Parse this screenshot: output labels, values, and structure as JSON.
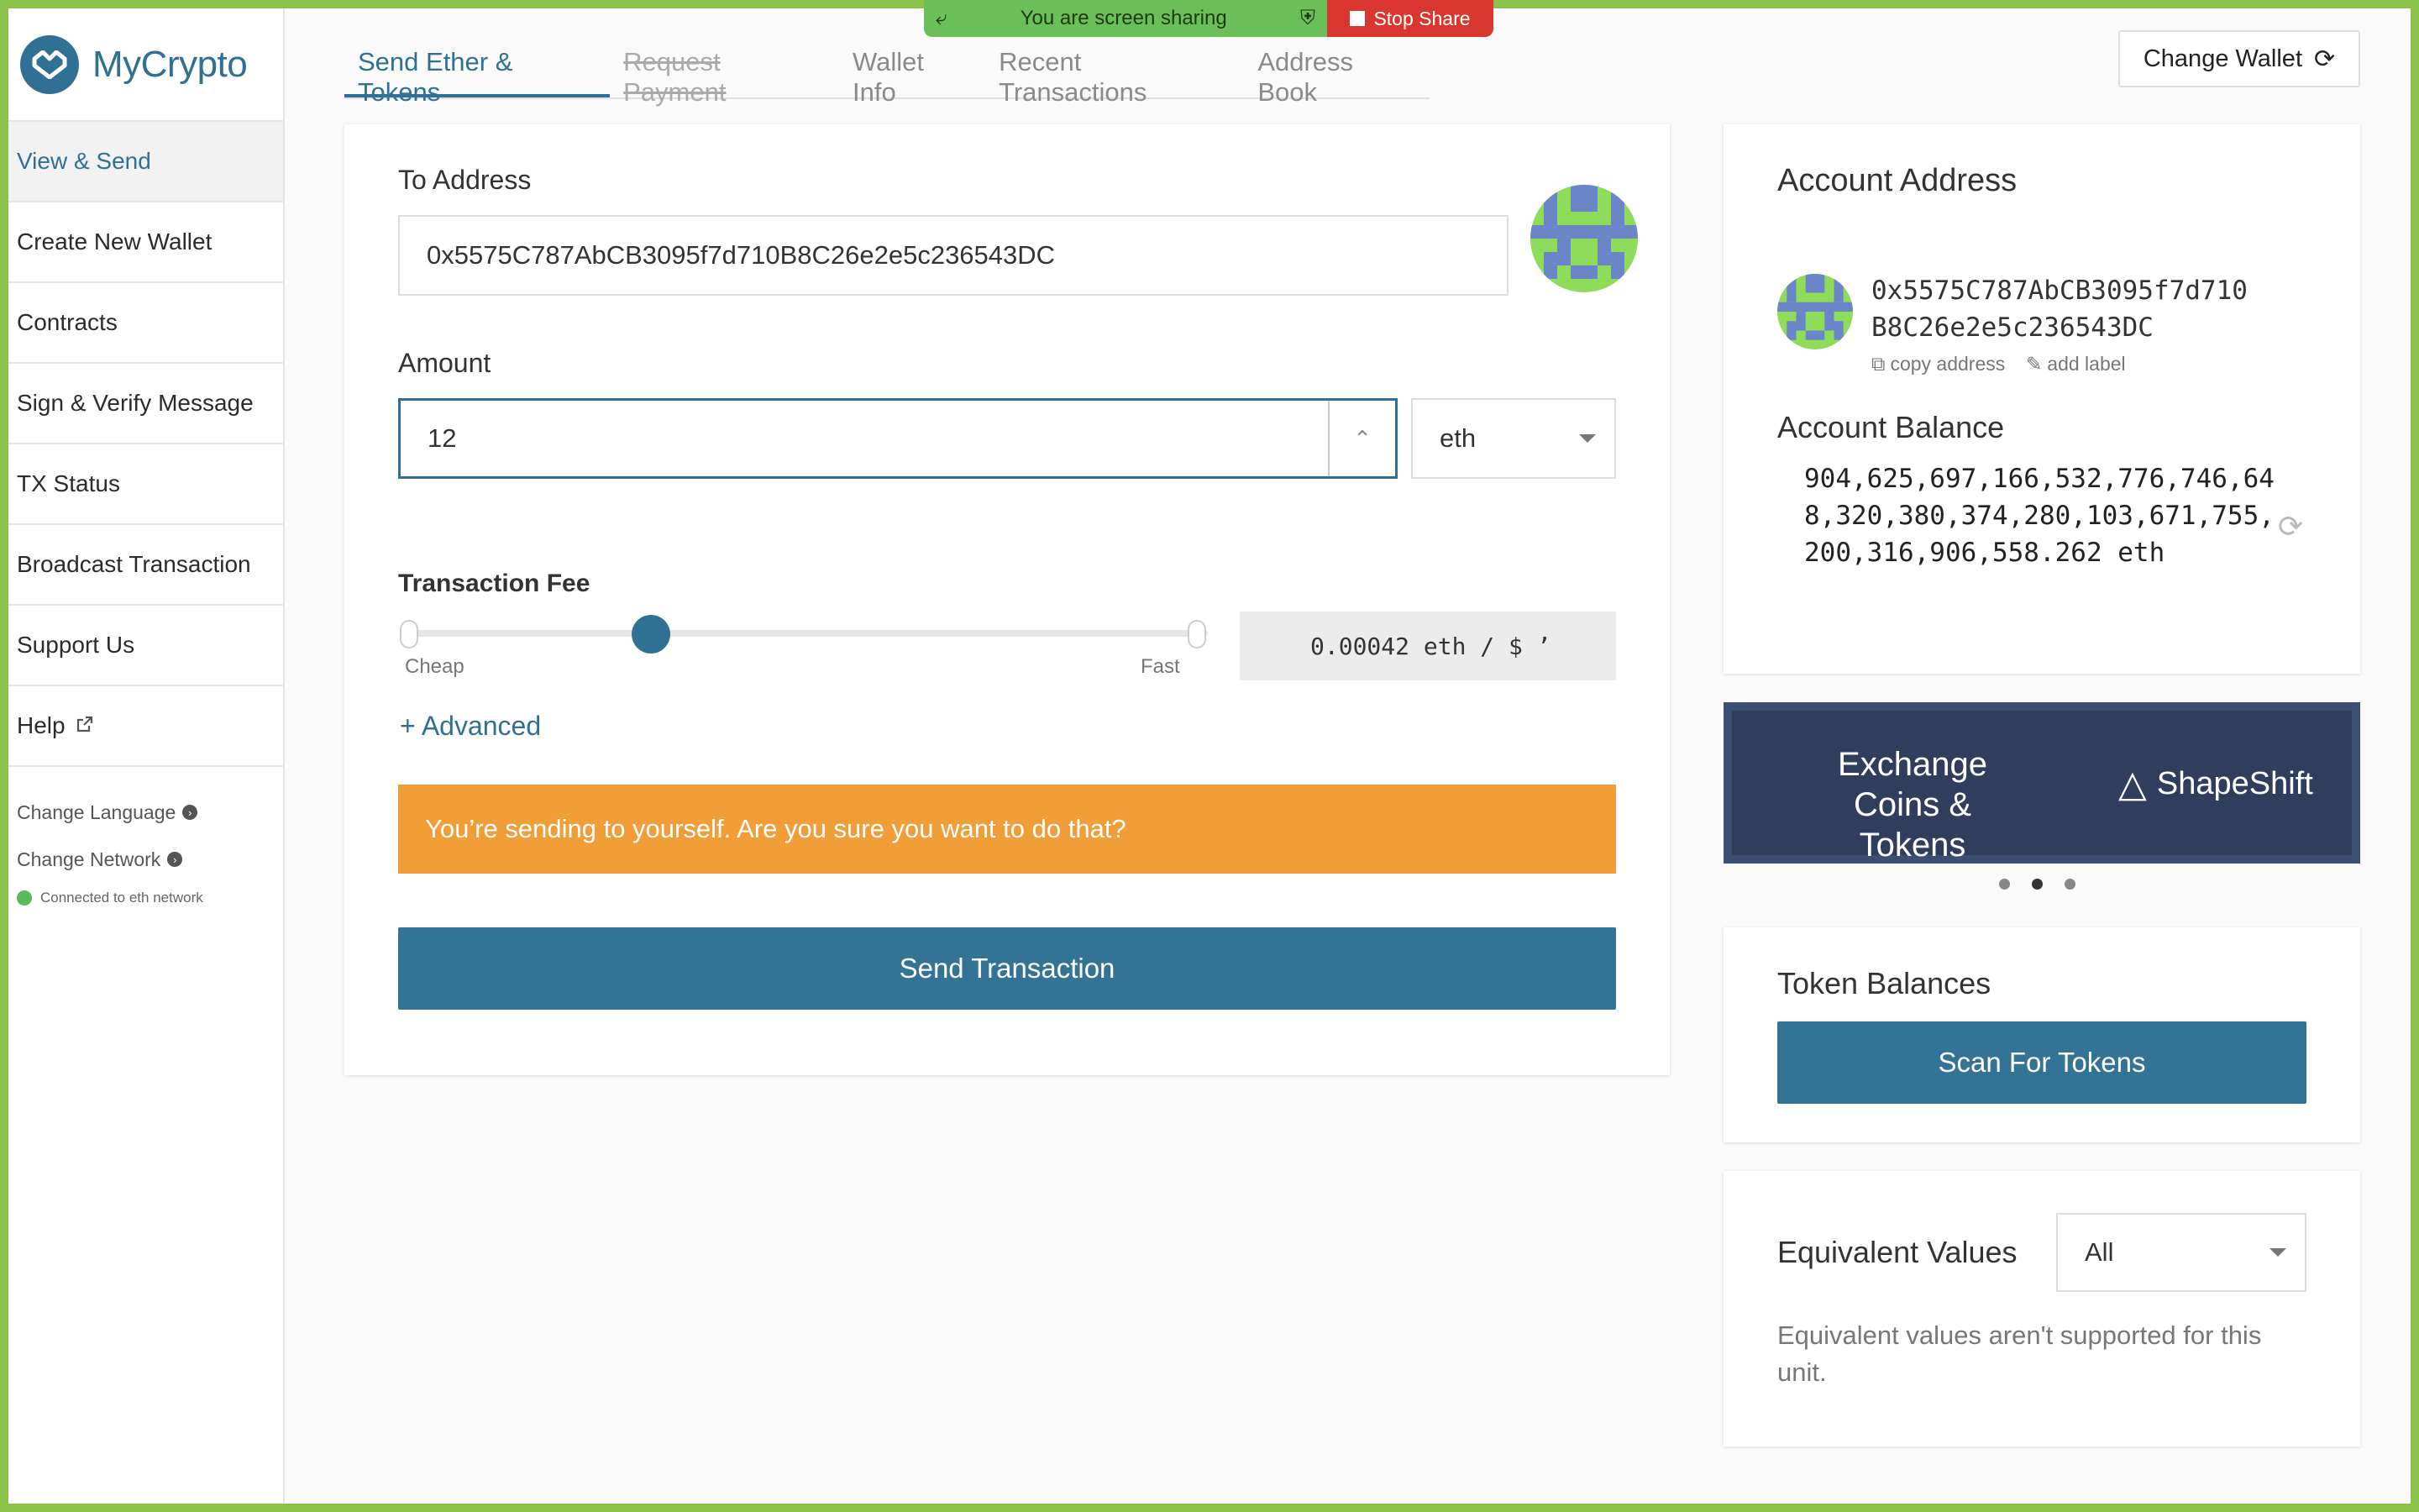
{
  "brand": {
    "name": "MyCrypto",
    "color": "#2f7094"
  },
  "screen_share": {
    "status": "You are screen sharing",
    "stop_label": "Stop Share"
  },
  "sidebar": {
    "items": [
      {
        "label": "View & Send",
        "active": true
      },
      {
        "label": "Create New Wallet"
      },
      {
        "label": "Contracts"
      },
      {
        "label": "Sign & Verify Message"
      },
      {
        "label": "TX Status"
      },
      {
        "label": "Broadcast Transaction"
      },
      {
        "label": "Support Us"
      },
      {
        "label": "Help",
        "icon": "external-link-icon"
      }
    ],
    "change_language": "Change Language",
    "change_network": "Change Network",
    "network_status": "Connected to eth network"
  },
  "tabs": [
    {
      "label": "Send Ether & Tokens",
      "active": true
    },
    {
      "label": "Request Payment",
      "disabled": true
    },
    {
      "label": "Wallet Info"
    },
    {
      "label": "Recent Transactions"
    },
    {
      "label": "Address Book"
    }
  ],
  "header": {
    "change_wallet_label": "Change Wallet"
  },
  "send_form": {
    "to_address_label": "To Address",
    "to_address_value": "0x5575C787AbCB3095f7d710B8C26e2e5c236543DC",
    "amount_label": "Amount",
    "amount_value": "12",
    "unit": "eth",
    "fee_label": "Transaction Fee",
    "fee_cheap": "Cheap",
    "fee_fast": "Fast",
    "fee_value": "0.00042 eth / $ ʼ",
    "advanced_label": "+ Advanced",
    "warning": "You’re sending to yourself. Are you sure you want to do that?",
    "send_button": "Send Transaction"
  },
  "account": {
    "title": "Account Address",
    "address_line1": "0x5575C787AbCB3095f7d710",
    "address_line2": "B8C26e2e5c236543DC",
    "copy_label": "copy address",
    "add_label": "add label",
    "balance_title": "Account Balance",
    "balance": "904,625,697,166,532,776,746,648,320,380,374,280,103,671,755,200,316,906,558.262 eth"
  },
  "promo": {
    "text": "Exchange Coins & Tokens",
    "brand": "ShapeShift",
    "slides": 3,
    "active_slide": 2
  },
  "tokens": {
    "title": "Token Balances",
    "scan_button": "Scan For Tokens"
  },
  "equivalent": {
    "title": "Equivalent Values",
    "select_value": "All",
    "note": "Equivalent values aren't supported for this unit."
  },
  "colors": {
    "accent": "#2f7094",
    "warning": "#f19d38",
    "frame": "#8bc34a"
  }
}
